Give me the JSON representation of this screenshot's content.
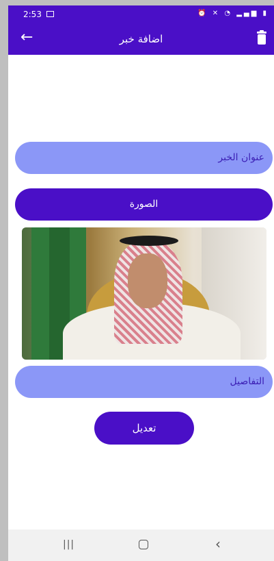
{
  "status_bar": {
    "time": "2:53"
  },
  "app_bar": {
    "title": "اضافة خبر",
    "back_icon": "arrow-left-icon",
    "delete_icon": "trash-icon",
    "color": "#4a0fc7"
  },
  "form": {
    "title_field_placeholder": "عنوان الخبر",
    "image_button_label": "الصورة",
    "details_field_placeholder": "التفاصيل",
    "edit_button_label": "تعديل"
  },
  "colors": {
    "primary": "#4a0fc7",
    "field_fill": "#8b97f7",
    "field_text": "#3b1fb5"
  },
  "nav_bar": {
    "recent_icon": "recent-apps-icon",
    "home_icon": "home-icon",
    "back_icon": "back-chevron-icon"
  }
}
